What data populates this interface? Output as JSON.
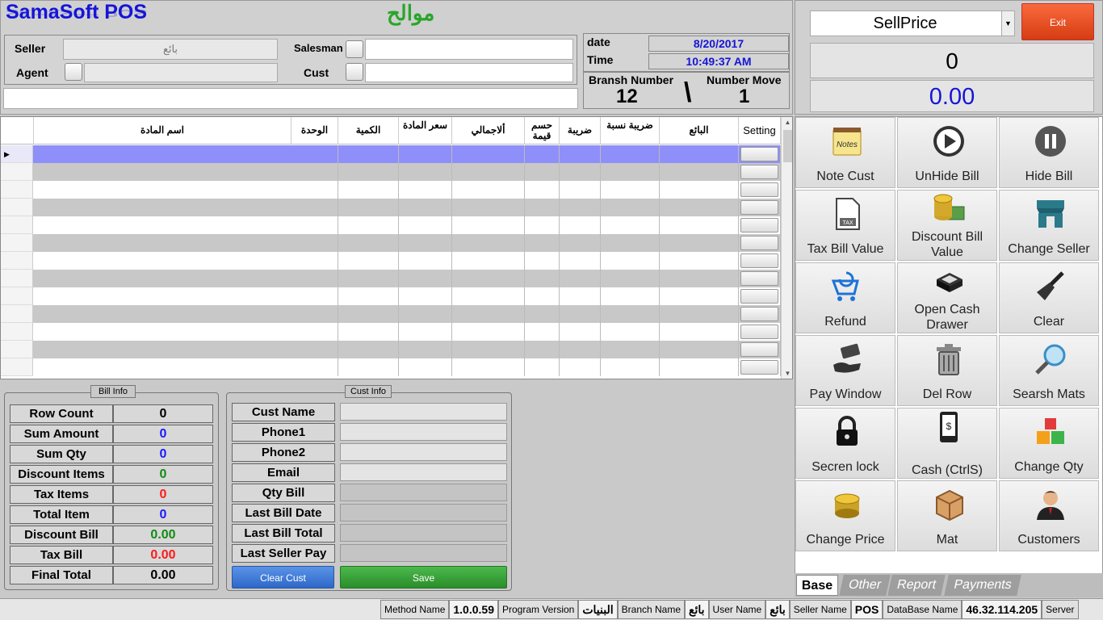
{
  "app": {
    "title": "SamaSoft POS",
    "logo_arabic": "موالح"
  },
  "header": {
    "seller_label": "Seller",
    "seller_value": "بائع",
    "agent_label": "Agent",
    "salesman_label": "Salesman",
    "cust_label": "Cust",
    "date_label": "date",
    "date_value": "8/20/2017",
    "time_label": "Time",
    "time_value": "10:49:37 AM",
    "branch_label": "Bransh Number",
    "branch_value": "12",
    "sep": "\\",
    "move_label": "Number Move",
    "move_value": "1"
  },
  "top_right": {
    "price_select": "SellPrice",
    "exit_label": "Exit",
    "qty_display": "0",
    "amount_display": "0.00"
  },
  "grid": {
    "columns": [
      "اسم المادة",
      "الوحدة",
      "الكمية",
      "سعر المادة",
      "ألاجمالي",
      "حسم قيمة",
      "ضريبة",
      "ضريبة نسبة",
      "البائع",
      "Setting"
    ],
    "row_count": 13
  },
  "bill_info": {
    "title": "Bill Info",
    "rows": [
      {
        "label": "Row Count",
        "value": "0",
        "color": "#000000"
      },
      {
        "label": "Sum Amount",
        "value": "0",
        "color": "#1a1aff"
      },
      {
        "label": "Sum Qty",
        "value": "0",
        "color": "#1a1aff"
      },
      {
        "label": "Discount Items",
        "value": "0",
        "color": "#138a13"
      },
      {
        "label": "Tax Items",
        "value": "0",
        "color": "#ff1a1a"
      },
      {
        "label": "Total Item",
        "value": "0",
        "color": "#1a1aff"
      },
      {
        "label": "Discount Bill",
        "value": "0.00",
        "color": "#138a13"
      },
      {
        "label": "Tax Bill",
        "value": "0.00",
        "color": "#ff1a1a"
      },
      {
        "label": "Final Total",
        "value": "0.00",
        "color": "#000000"
      }
    ]
  },
  "cust_info": {
    "title": "Cust Info",
    "fields": [
      "Cust Name",
      "Phone1",
      "Phone2",
      "Email",
      "Qty Bill",
      "Last Bill Date",
      "Last Bill Total",
      "Last Seller Pay"
    ],
    "clear_label": "Clear Cust",
    "save_label": "Save"
  },
  "tools": [
    {
      "label": "Note Cust",
      "icon": "notes-icon"
    },
    {
      "label": "UnHide Bill",
      "icon": "play-icon"
    },
    {
      "label": "Hide Bill",
      "icon": "pause-icon"
    },
    {
      "label": "Tax Bill Value",
      "icon": "tax-document-icon"
    },
    {
      "label": "Discount Bill Value",
      "icon": "coins-money-icon"
    },
    {
      "label": "Change Seller",
      "icon": "store-icon"
    },
    {
      "label": "Refund",
      "icon": "cart-refund-icon"
    },
    {
      "label": "Open Cash Drawer",
      "icon": "cash-drawer-icon"
    },
    {
      "label": "Clear",
      "icon": "broom-icon"
    },
    {
      "label": "Pay Window",
      "icon": "hand-money-icon"
    },
    {
      "label": "Del Row",
      "icon": "trash-icon"
    },
    {
      "label": "Searsh Mats",
      "icon": "magnifier-icon"
    },
    {
      "label": "Secren lock",
      "icon": "lock-icon"
    },
    {
      "label": "Cash (CtrlS)",
      "icon": "phone-cash-icon"
    },
    {
      "label": "Change Qty",
      "icon": "boxes-icon"
    },
    {
      "label": "Change Price",
      "icon": "gold-coins-icon"
    },
    {
      "label": "Mat",
      "icon": "crate-icon"
    },
    {
      "label": "Customers",
      "icon": "user-icon"
    }
  ],
  "tabs": [
    "Base",
    "Other",
    "Report",
    "Payments"
  ],
  "status": {
    "method_label": "Method Name",
    "version_value": "1.0.0.59",
    "version_label": "Program Version",
    "branch_value": "البنيات",
    "branch_label": "Branch Name",
    "user_value": "بائع",
    "user_label": "User Name",
    "seller_value": "بائع",
    "seller_label": "Seller Name",
    "db_value": "POS",
    "db_label": "DataBase Name",
    "server_value": "46.32.114.205",
    "server_label": "Server"
  }
}
